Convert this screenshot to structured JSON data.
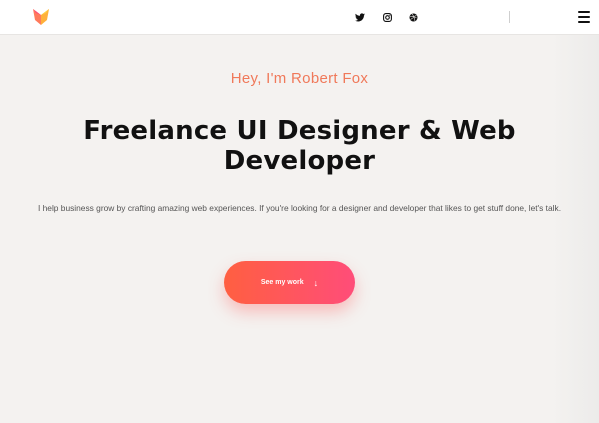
{
  "header": {
    "logo": "fox-logo-icon",
    "social": [
      {
        "name": "twitter",
        "icon": "twitter-icon"
      },
      {
        "name": "instagram",
        "icon": "instagram-icon"
      },
      {
        "name": "dribbble",
        "icon": "dribbble-icon"
      }
    ],
    "menu_icon": "hamburger-menu-icon"
  },
  "hero": {
    "greeting": "Hey, I'm Robert Fox",
    "headline": "Freelance UI Designer & Web Developer",
    "subtext": "I help business grow by crafting amazing web experiences. If you're looking for a designer and developer that likes to get stuff done, let's talk.",
    "cta_label": "See my work",
    "cta_arrow": "↓"
  },
  "colors": {
    "accent": "#f0795a",
    "cta_start": "#ff5f41",
    "cta_end": "#ff4d79",
    "background": "#f4f2f0"
  }
}
